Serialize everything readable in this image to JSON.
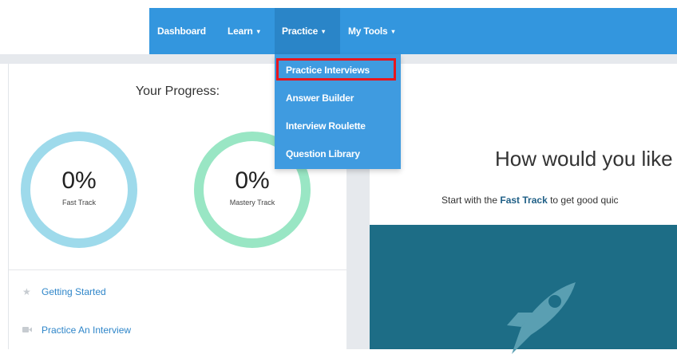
{
  "nav": {
    "items": [
      {
        "label": "Dashboard",
        "caret": ""
      },
      {
        "label": "Learn",
        "caret": "▾"
      },
      {
        "label": "Practice",
        "caret": "▾"
      },
      {
        "label": "My Tools",
        "caret": "▾"
      }
    ]
  },
  "practice_menu": {
    "items": [
      {
        "label": "Practice Interviews"
      },
      {
        "label": "Answer Builder"
      },
      {
        "label": "Interview Roulette"
      },
      {
        "label": "Question Library"
      }
    ]
  },
  "progress": {
    "title": "Your Progress:",
    "fast": {
      "value": "0%",
      "label": "Fast Track"
    },
    "mastery": {
      "value": "0%",
      "label": "Mastery Track"
    }
  },
  "links": [
    {
      "label": "Getting Started",
      "icon": "star-icon"
    },
    {
      "label": "Practice An Interview",
      "icon": "video-camera-icon"
    }
  ],
  "main": {
    "heading": "How would you like",
    "sub_prefix": "Start with the ",
    "sub_bold": "Fast Track",
    "sub_suffix": " to get good quic"
  },
  "colors": {
    "nav_bg": "#3396de",
    "dropdown_bg": "#3f9be0",
    "highlight_border": "#e8161d",
    "fast_ring": "#9edaeb",
    "mastery_ring": "#99e6c4",
    "hero_bg": "#1d6d86",
    "link": "#2f86c9"
  }
}
